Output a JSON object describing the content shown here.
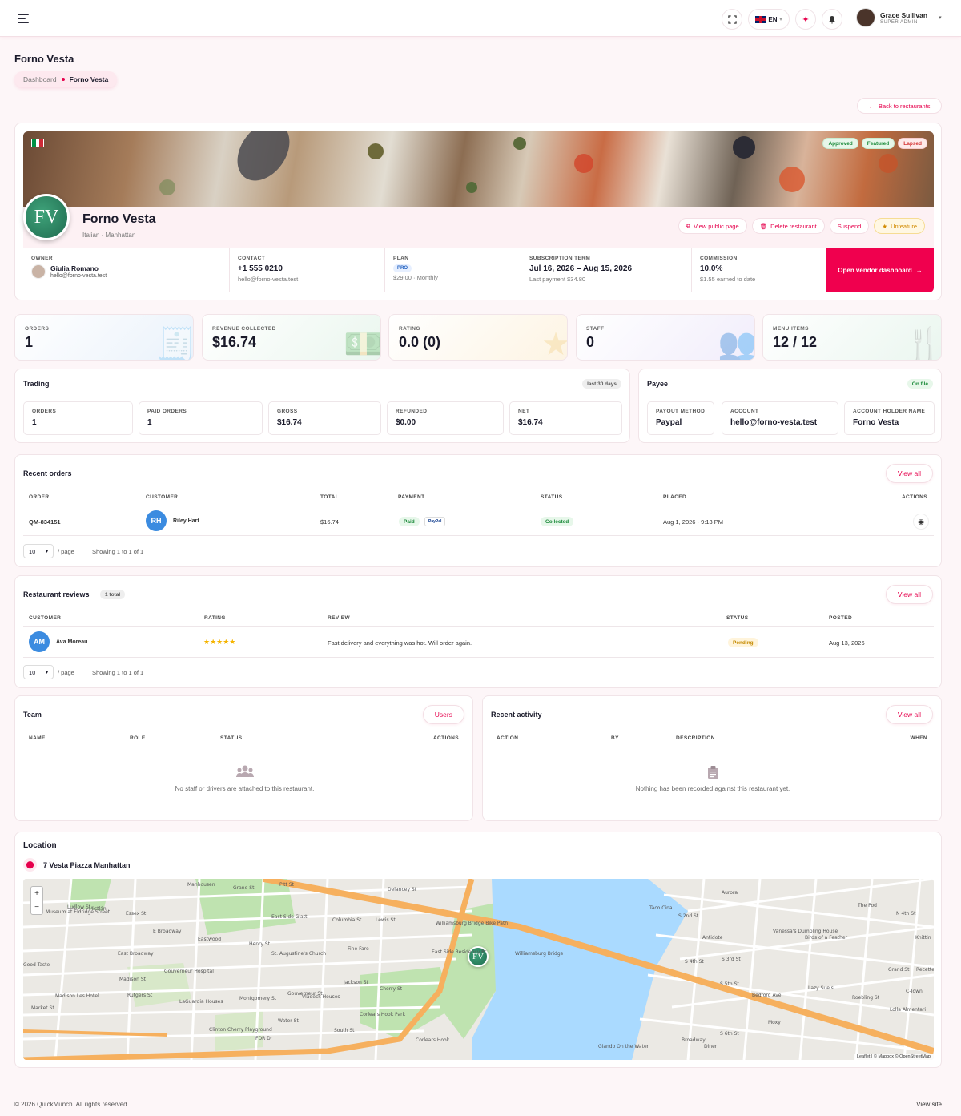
{
  "topbar": {
    "lang": "EN",
    "user_name": "Grace Sullivan",
    "user_role": "SUPER ADMIN"
  },
  "page": {
    "title": "Forno Vesta",
    "breadcrumb": [
      "Dashboard",
      "Forno Vesta"
    ],
    "back_label": "Back to restaurants"
  },
  "restaurant": {
    "name": "Forno Vesta",
    "initials": "FV",
    "subtitle": "Italian · Manhattan",
    "badges": [
      "Approved",
      "Featured",
      "Lapsed"
    ],
    "actions": {
      "view_public": "View public page",
      "delete": "Delete restaurant",
      "suspend": "Suspend",
      "unfeature": "Unfeature"
    },
    "owner": {
      "label": "OWNER",
      "name": "Giulia Romano",
      "email": "hello@forno-vesta.test"
    },
    "contact": {
      "label": "CONTACT",
      "phone": "+1 555 0210",
      "email": "hello@forno-vesta.test"
    },
    "plan": {
      "label": "PLAN",
      "tier": "PRO",
      "price": "$29.00 · Monthly"
    },
    "term": {
      "label": "SUBSCRIPTION TERM",
      "range": "Jul 16, 2026 – Aug 15, 2026",
      "last_payment": "Last payment $34.80"
    },
    "commission": {
      "label": "COMMISSION",
      "rate": "10.0%",
      "earned": "$1.55 earned to date"
    },
    "vendor_btn": "Open vendor dashboard"
  },
  "kpis": [
    {
      "label": "ORDERS",
      "value": "1",
      "icon": "receipt-icon",
      "bg": "#eaf2fb",
      "ic": "#9cc0e6"
    },
    {
      "label": "REVENUE COLLECTED",
      "value": "$16.74",
      "icon": "cash-icon",
      "bg": "#eaf6ee",
      "ic": "#8fd0a4"
    },
    {
      "label": "RATING",
      "value": "0.0 (0)",
      "icon": "star-icon",
      "bg": "#fdf4e3",
      "ic": "#f1cf82"
    },
    {
      "label": "STAFF",
      "value": "0",
      "icon": "users-icon",
      "bg": "#f1edfb",
      "ic": "#c4b6ee"
    },
    {
      "label": "MENU ITEMS",
      "value": "12 / 12",
      "icon": "utensils-icon",
      "bg": "#eaf6ef",
      "ic": "#9ad6b2"
    }
  ],
  "trading": {
    "title": "Trading",
    "period": "last 30 days",
    "items": [
      {
        "label": "ORDERS",
        "value": "1"
      },
      {
        "label": "PAID ORDERS",
        "value": "1"
      },
      {
        "label": "GROSS",
        "value": "$16.74"
      },
      {
        "label": "REFUNDED",
        "value": "$0.00"
      },
      {
        "label": "NET",
        "value": "$16.74"
      }
    ]
  },
  "payee": {
    "title": "Payee",
    "status": "On file",
    "items": [
      {
        "label": "PAYOUT METHOD",
        "value": "Paypal"
      },
      {
        "label": "ACCOUNT",
        "value": "hello@forno-vesta.test"
      },
      {
        "label": "ACCOUNT HOLDER NAME",
        "value": "Forno Vesta"
      }
    ]
  },
  "orders": {
    "title": "Recent orders",
    "view_all": "View all",
    "columns": [
      "ORDER",
      "CUSTOMER",
      "TOTAL",
      "PAYMENT",
      "STATUS",
      "PLACED",
      "ACTIONS"
    ],
    "row": {
      "id": "QM-834151",
      "initials": "RH",
      "customer": "Riley Hart",
      "total": "$16.74",
      "payment": "Paid",
      "method": "PayPal",
      "status": "Collected",
      "placed": "Aug 1, 2026 · 9:13 PM"
    },
    "per_page": "10",
    "per_page_label": "/ page",
    "showing": "Showing 1 to 1 of 1"
  },
  "reviews": {
    "title": "Restaurant reviews",
    "total": "1 total",
    "view_all": "View all",
    "columns": [
      "CUSTOMER",
      "RATING",
      "REVIEW",
      "STATUS",
      "POSTED"
    ],
    "row": {
      "initials": "AM",
      "customer": "Ava Moreau",
      "stars": "★★★★★",
      "rating": 5,
      "review": "Fast delivery and everything was hot. Will order again.",
      "status": "Pending",
      "posted": "Aug 13, 2026"
    },
    "per_page": "10",
    "per_page_label": "/ page",
    "showing": "Showing 1 to 1 of 1"
  },
  "team": {
    "title": "Team",
    "button": "Users",
    "columns": [
      "NAME",
      "ROLE",
      "STATUS",
      "ACTIONS"
    ],
    "empty": "No staff or drivers are attached to this restaurant."
  },
  "activity": {
    "title": "Recent activity",
    "view_all": "View all",
    "columns": [
      "ACTION",
      "BY",
      "DESCRIPTION",
      "WHEN"
    ],
    "empty": "Nothing has been recorded against this restaurant yet."
  },
  "location": {
    "title": "Location",
    "address": "7 Vesta Piazza Manhattan",
    "attribution": "Leaflet | © Mapbox © OpenStreetMap",
    "labels": [
      "Manhousen",
      "Grand St",
      "Delancey St",
      "Museum at Eldridge Street",
      "Mictlán",
      "E Broadway",
      "East Side Glatt",
      "Eastwood",
      "East Broadway",
      "Henry St",
      "St. Augustine's Church",
      "Fine Fare",
      "Williamsburg Bridge Bike Path",
      "East Side Residency Pr",
      "Williamsburg Bridge",
      "Gouverneur Hospital",
      "Madison St",
      "Madison Les Hotel",
      "LaGuardia Houses",
      "Vladeck Houses",
      "Cherry St",
      "Corlears Hook Park",
      "Clinton Cherry Playground",
      "Water St",
      "South St",
      "FDR Dr",
      "Corlears Hook",
      "Taco Cina",
      "S 2nd St",
      "Antidote",
      "S 3rd St",
      "Vanessa's Dumpling House",
      "Birds of a Feather",
      "S 4th St",
      "S 5th St",
      "Lazy Sue's",
      "Broadway",
      "Diner",
      "Grand St",
      "Roebling St",
      "Lolla Almentari",
      "C-Town",
      "The Pod",
      "N 4th St",
      "Knittin",
      "Recette",
      "Aurora",
      "Moxy",
      "Bedford Ave",
      "S 6th St",
      "Giando On the Water",
      "Ludlow St",
      "Essex St",
      "Lewis St",
      "Columbia St",
      "Rutgers St",
      "Montgomery St",
      "Gouverneur St",
      "Jackson St",
      "Market St",
      "Good Taste",
      "Pitt St"
    ]
  },
  "footer": {
    "copyright": "© 2026 QuickMunch. All rights reserved.",
    "view_site": "View site"
  },
  "colors": {
    "accent": "#e6004c",
    "vendor_btn": "#f0004e"
  }
}
